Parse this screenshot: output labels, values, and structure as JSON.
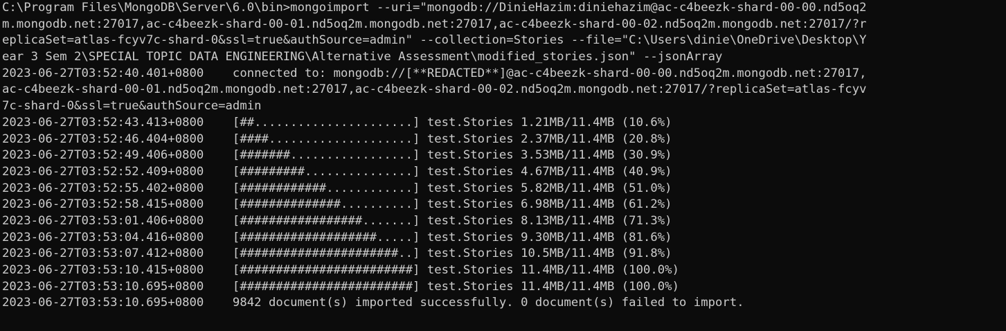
{
  "terminal": {
    "lines": [
      "C:\\Program Files\\MongoDB\\Server\\6.0\\bin>mongoimport --uri=\"mongodb://DinieHazim:diniehazim@ac-c4beezk-shard-00-00.nd5oq2",
      "m.mongodb.net:27017,ac-c4beezk-shard-00-01.nd5oq2m.mongodb.net:27017,ac-c4beezk-shard-00-02.nd5oq2m.mongodb.net:27017/?r",
      "eplicaSet=atlas-fcyv7c-shard-0&ssl=true&authSource=admin\" --collection=Stories --file=\"C:\\Users\\dinie\\OneDrive\\Desktop\\Y",
      "ear 3 Sem 2\\SPECIAL TOPIC DATA ENGINEERING\\Alternative Assessment\\modified_stories.json\" --jsonArray",
      "2023-06-27T03:52:40.401+0800    connected to: mongodb://[**REDACTED**]@ac-c4beezk-shard-00-00.nd5oq2m.mongodb.net:27017,",
      "ac-c4beezk-shard-00-01.nd5oq2m.mongodb.net:27017,ac-c4beezk-shard-00-02.nd5oq2m.mongodb.net:27017/?replicaSet=atlas-fcyv",
      "7c-shard-0&ssl=true&authSource=admin",
      "2023-06-27T03:52:43.413+0800    [##......................] test.Stories 1.21MB/11.4MB (10.6%)",
      "2023-06-27T03:52:46.404+0800    [####....................] test.Stories 2.37MB/11.4MB (20.8%)",
      "2023-06-27T03:52:49.406+0800    [#######.................] test.Stories 3.53MB/11.4MB (30.9%)",
      "2023-06-27T03:52:52.409+0800    [#########...............] test.Stories 4.67MB/11.4MB (40.9%)",
      "2023-06-27T03:52:55.402+0800    [############............] test.Stories 5.82MB/11.4MB (51.0%)",
      "2023-06-27T03:52:58.415+0800    [##############..........] test.Stories 6.98MB/11.4MB (61.2%)",
      "2023-06-27T03:53:01.406+0800    [#################.......] test.Stories 8.13MB/11.4MB (71.3%)",
      "2023-06-27T03:53:04.416+0800    [###################.....] test.Stories 9.30MB/11.4MB (81.6%)",
      "2023-06-27T03:53:07.412+0800    [######################..] test.Stories 10.5MB/11.4MB (91.8%)",
      "2023-06-27T03:53:10.415+0800    [########################] test.Stories 11.4MB/11.4MB (100.0%)",
      "2023-06-27T03:53:10.695+0800    [########################] test.Stories 11.4MB/11.4MB (100.0%)",
      "2023-06-27T03:53:10.695+0800    9842 document(s) imported successfully. 0 document(s) failed to import."
    ]
  }
}
